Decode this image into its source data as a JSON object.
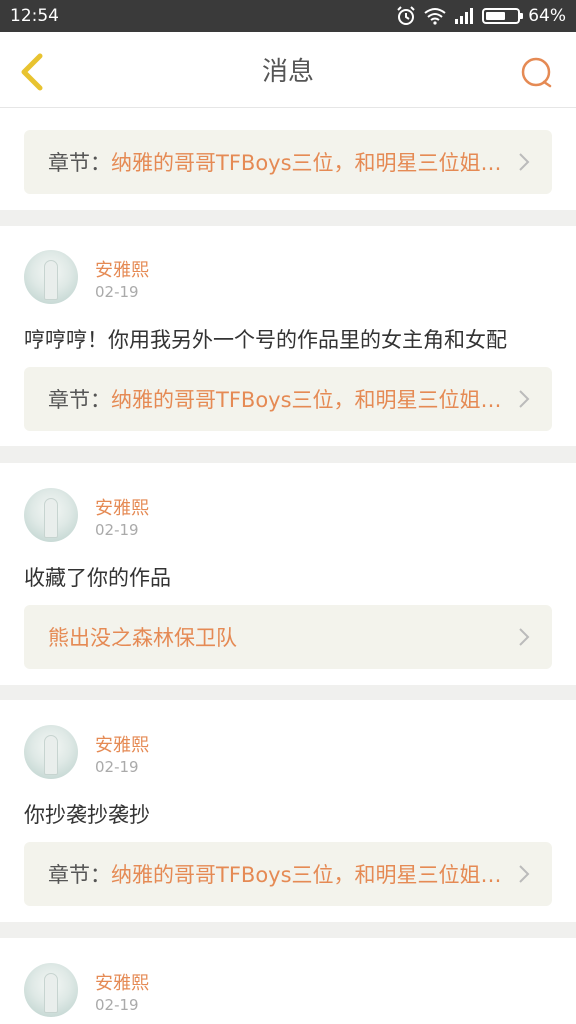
{
  "statusbar": {
    "time": "12:54",
    "battery": "64%",
    "battery_level": 0.64
  },
  "header": {
    "title": "消息"
  },
  "partial_top": {
    "chapter_label": "章节：",
    "chapter_text": "纳雅的哥哥TFBoys三位，和明星三位姐…"
  },
  "messages": [
    {
      "username": "安雅熙",
      "date": "02-19",
      "text": "哼哼哼！你用我另外一个号的作品里的女主角和女配",
      "chapter_label": "章节：",
      "chapter_text": "纳雅的哥哥TFBoys三位，和明星三位姐…"
    },
    {
      "username": "安雅熙",
      "date": "02-19",
      "text": "收藏了你的作品",
      "chapter_label": "",
      "chapter_text": "熊出没之森林保卫队"
    },
    {
      "username": "安雅熙",
      "date": "02-19",
      "text": "你抄袭抄袭抄",
      "chapter_label": "章节：",
      "chapter_text": "纳雅的哥哥TFBoys三位，和明星三位姐…"
    },
    {
      "username": "安雅熙",
      "date": "02-19"
    }
  ],
  "colors": {
    "accent": "#e58a54",
    "back_icon": "#e8c330",
    "link_bg": "#f3f3ec"
  }
}
